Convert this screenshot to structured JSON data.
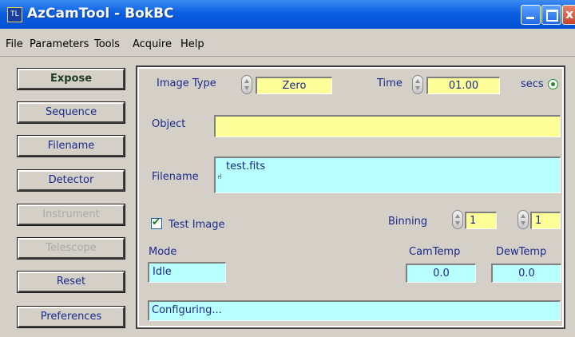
{
  "window": {
    "title": "AzCamTool - BokBC",
    "icon_text": "TL",
    "close_glyph": "x"
  },
  "menu": [
    "File",
    "Parameters",
    "Tools",
    "Acquire",
    "Help"
  ],
  "sidebar": [
    {
      "label": "Expose",
      "enabled": true
    },
    {
      "label": "Sequence",
      "enabled": true
    },
    {
      "label": "Filename",
      "enabled": true
    },
    {
      "label": "Detector",
      "enabled": true
    },
    {
      "label": "Instrument",
      "enabled": false
    },
    {
      "label": "Telescope",
      "enabled": false
    },
    {
      "label": "Reset",
      "enabled": true
    },
    {
      "label": "Preferences",
      "enabled": true
    }
  ],
  "main": {
    "image_type_label": "Image Type",
    "image_type_value": "Zero",
    "time_label": "Time",
    "time_value": "01.00",
    "time_unit": "secs",
    "object_label": "Object",
    "object_value": "",
    "filename_label": "Filename",
    "filename_value": "test.fits",
    "test_image_label": "Test Image",
    "test_image_checked": true,
    "binning_label": "Binning",
    "binning_x": "1",
    "binning_y": "1",
    "mode_label": "Mode",
    "mode_value": "Idle",
    "camtemp_label": "CamTemp",
    "camtemp_value": "0.0",
    "dewtemp_label": "DewTemp",
    "dewtemp_value": "0.0",
    "status_value": "Configuring..."
  },
  "colors": {
    "input_yellow": "#ffff99",
    "input_cyan": "#b8ffff",
    "label_blue": "#1b2a8a",
    "titlebar": "#0a5fe0"
  }
}
